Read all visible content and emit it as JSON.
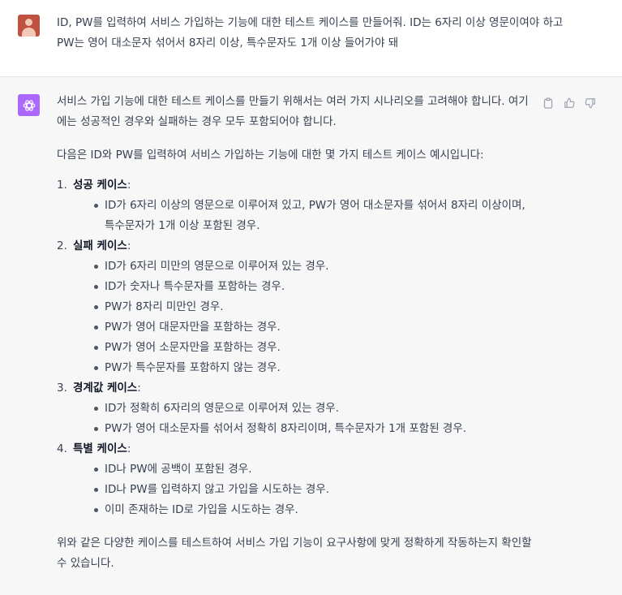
{
  "user": {
    "message": "ID, PW를 입력하여 서비스 가입하는 기능에 대한 테스트 케이스를 만들어줘. ID는 6자리 이상 영문이여야 하고 PW는 영어 대소문자 섞어서 8자리 이상, 특수문자도 1개 이상 들어가야 돼"
  },
  "assistant": {
    "intro": "서비스 가입 기능에 대한 테스트 케이스를 만들기 위해서는 여러 가지 시나리오를 고려해야 합니다. 여기에는 성공적인 경우와 실패하는 경우 모두 포함되어야 합니다.",
    "lead": "다음은 ID와 PW를 입력하여 서비스 가입하는 기능에 대한 몇 가지 테스트 케이스 예시입니다:",
    "sections": [
      {
        "num": "1.",
        "title": "성공 케이스",
        "colon": ":",
        "items": [
          "ID가 6자리 이상의 영문으로 이루어져 있고, PW가 영어 대소문자를 섞어서 8자리 이상이며, 특수문자가 1개 이상 포함된 경우."
        ]
      },
      {
        "num": "2.",
        "title": "실패 케이스",
        "colon": ":",
        "items": [
          "ID가 6자리 미만의 영문으로 이루어져 있는 경우.",
          "ID가 숫자나 특수문자를 포함하는 경우.",
          "PW가 8자리 미만인 경우.",
          "PW가 영어 대문자만을 포함하는 경우.",
          "PW가 영어 소문자만을 포함하는 경우.",
          "PW가 특수문자를 포함하지 않는 경우."
        ]
      },
      {
        "num": "3.",
        "title": "경계값 케이스",
        "colon": ":",
        "items": [
          "ID가 정확히 6자리의 영문으로 이루어져 있는 경우.",
          "PW가 영어 대소문자를 섞어서 정확히 8자리이며, 특수문자가 1개 포함된 경우."
        ]
      },
      {
        "num": "4.",
        "title": "특별 케이스",
        "colon": ":",
        "items": [
          "ID나 PW에 공백이 포함된 경우.",
          "ID나 PW를 입력하지 않고 가입을 시도하는 경우.",
          "이미 존재하는 ID로 가입을 시도하는 경우."
        ]
      }
    ],
    "outro": "위와 같은 다양한 케이스를 테스트하여 서비스 가입 기능이 요구사항에 맞게 정확하게 작동하는지 확인할 수 있습니다."
  },
  "actions": [
    "copy-icon",
    "thumbs-up-icon",
    "thumbs-down-icon"
  ]
}
